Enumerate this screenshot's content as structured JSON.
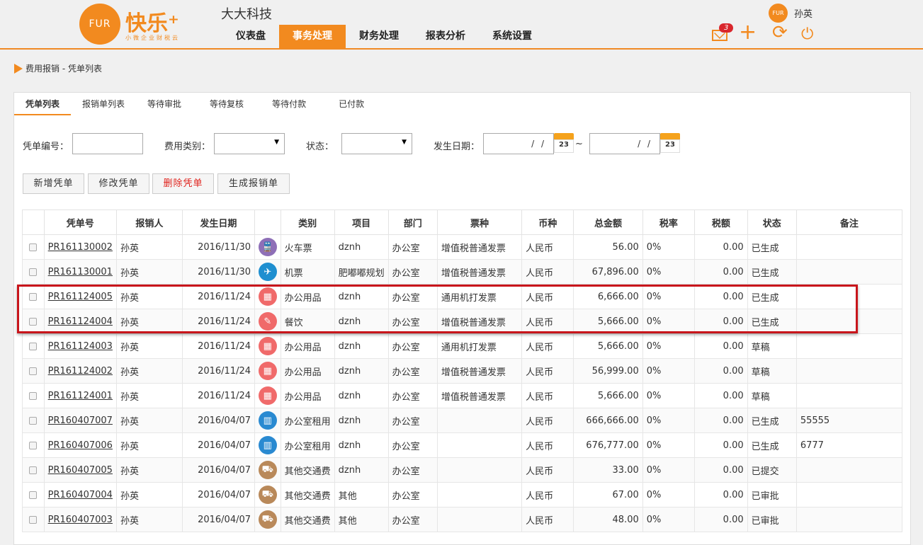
{
  "brand": {
    "logo_mark": "FUR",
    "logo_text": "快乐⁺",
    "logo_sub": "小微企业财税云",
    "company": "大大科技"
  },
  "nav": [
    "仪表盘",
    "事务处理",
    "财务处理",
    "报表分析",
    "系统设置"
  ],
  "nav_active": 1,
  "user": {
    "avatar": "FUR",
    "name": "孙英"
  },
  "header_icons": {
    "mail_badge": "3",
    "mail": "mail-icon",
    "plus": "+",
    "refresh": "⟳",
    "power": "⏻"
  },
  "breadcrumb": "费用报销 - 凭单列表",
  "tabs": [
    "凭单列表",
    "报销单列表",
    "等待审批",
    "等待复核",
    "等待付款",
    "已付款"
  ],
  "filters": {
    "voucher_no_label": "凭单编号：",
    "expense_type_label": "费用类别：",
    "status_label": "状态：",
    "date_label": "发生日期：",
    "date_placeholder": "/ /",
    "date_sep": "~",
    "cal_day": "23"
  },
  "buttons": [
    "新增凭单",
    "修改凭单",
    "删除凭单",
    "生成报销单"
  ],
  "columns": [
    "",
    "凭单号",
    "报销人",
    "发生日期",
    "",
    "类别",
    "项目",
    "部门",
    "票种",
    "币种",
    "总金额",
    "税率",
    "税额",
    "状态",
    "备注"
  ],
  "rows": [
    {
      "id": "PR161130002",
      "person": "孙英",
      "date": "2016/11/30",
      "icon": "train-icon",
      "cat": "火车票",
      "project": "dznh",
      "dept": "办公室",
      "ticket": "增值税普通发票",
      "currency": "人民币",
      "amount": "56.00",
      "rate": "0%",
      "tax": "0.00",
      "status": "已生成",
      "note": ""
    },
    {
      "id": "PR161130001",
      "person": "孙英",
      "date": "2016/11/30",
      "icon": "plane-icon",
      "cat": "机票",
      "project": "肥嘟嘟规划",
      "dept": "办公室",
      "ticket": "增值税普通发票",
      "currency": "人民币",
      "amount": "67,896.00",
      "rate": "0%",
      "tax": "0.00",
      "status": "已生成",
      "note": ""
    },
    {
      "id": "PR161124005",
      "person": "孙英",
      "date": "2016/11/24",
      "icon": "calculator-icon",
      "cat": "办公用品",
      "project": "dznh",
      "dept": "办公室",
      "ticket": "通用机打发票",
      "currency": "人民币",
      "amount": "6,666.00",
      "rate": "0%",
      "tax": "0.00",
      "status": "已生成",
      "note": ""
    },
    {
      "id": "PR161124004",
      "person": "孙英",
      "date": "2016/11/24",
      "icon": "dining-icon",
      "cat": "餐饮",
      "project": "dznh",
      "dept": "办公室",
      "ticket": "增值税普通发票",
      "currency": "人民币",
      "amount": "5,666.00",
      "rate": "0%",
      "tax": "0.00",
      "status": "已生成",
      "note": ""
    },
    {
      "id": "PR161124003",
      "person": "孙英",
      "date": "2016/11/24",
      "icon": "calculator-icon",
      "cat": "办公用品",
      "project": "dznh",
      "dept": "办公室",
      "ticket": "通用机打发票",
      "currency": "人民币",
      "amount": "5,666.00",
      "rate": "0%",
      "tax": "0.00",
      "status": "草稿",
      "note": ""
    },
    {
      "id": "PR161124002",
      "person": "孙英",
      "date": "2016/11/24",
      "icon": "calculator-icon",
      "cat": "办公用品",
      "project": "dznh",
      "dept": "办公室",
      "ticket": "增值税普通发票",
      "currency": "人民币",
      "amount": "56,999.00",
      "rate": "0%",
      "tax": "0.00",
      "status": "草稿",
      "note": ""
    },
    {
      "id": "PR161124001",
      "person": "孙英",
      "date": "2016/11/24",
      "icon": "calculator-icon",
      "cat": "办公用品",
      "project": "dznh",
      "dept": "办公室",
      "ticket": "增值税普通发票",
      "currency": "人民币",
      "amount": "5,666.00",
      "rate": "0%",
      "tax": "0.00",
      "status": "草稿",
      "note": ""
    },
    {
      "id": "PR160407007",
      "person": "孙英",
      "date": "2016/04/07",
      "icon": "building-icon",
      "cat": "办公室租用",
      "project": "dznh",
      "dept": "办公室",
      "ticket": "",
      "currency": "人民币",
      "amount": "666,666.00",
      "rate": "0%",
      "tax": "0.00",
      "status": "已生成",
      "note": "55555"
    },
    {
      "id": "PR160407006",
      "person": "孙英",
      "date": "2016/04/07",
      "icon": "building-icon",
      "cat": "办公室租用",
      "project": "dznh",
      "dept": "办公室",
      "ticket": "",
      "currency": "人民币",
      "amount": "676,777.00",
      "rate": "0%",
      "tax": "0.00",
      "status": "已生成",
      "note": "6777"
    },
    {
      "id": "PR160407005",
      "person": "孙英",
      "date": "2016/04/07",
      "icon": "truck-icon",
      "cat": "其他交通费",
      "project": "dznh",
      "dept": "办公室",
      "ticket": "",
      "currency": "人民币",
      "amount": "33.00",
      "rate": "0%",
      "tax": "0.00",
      "status": "已提交",
      "note": ""
    },
    {
      "id": "PR160407004",
      "person": "孙英",
      "date": "2016/04/07",
      "icon": "truck-icon",
      "cat": "其他交通费",
      "project": "其他",
      "dept": "办公室",
      "ticket": "",
      "currency": "人民币",
      "amount": "67.00",
      "rate": "0%",
      "tax": "0.00",
      "status": "已审批",
      "note": ""
    },
    {
      "id": "PR160407003",
      "person": "孙英",
      "date": "2016/04/07",
      "icon": "truck-icon",
      "cat": "其他交通费",
      "project": "其他",
      "dept": "办公室",
      "ticket": "",
      "currency": "人民币",
      "amount": "48.00",
      "rate": "0%",
      "tax": "0.00",
      "status": "已审批",
      "note": ""
    }
  ],
  "icon_colors": {
    "train-icon": "#8e6fb7",
    "plane-icon": "#1f8fd0",
    "calculator-icon": "#f06a6a",
    "dining-icon": "#f06a6a",
    "building-icon": "#2a8ad1",
    "truck-icon": "#b9895a"
  },
  "icon_glyphs": {
    "train-icon": "🚆",
    "plane-icon": "✈",
    "calculator-icon": "▦",
    "dining-icon": "✎",
    "building-icon": "▥",
    "truck-icon": "⛟"
  },
  "accent": "#f28a1f"
}
